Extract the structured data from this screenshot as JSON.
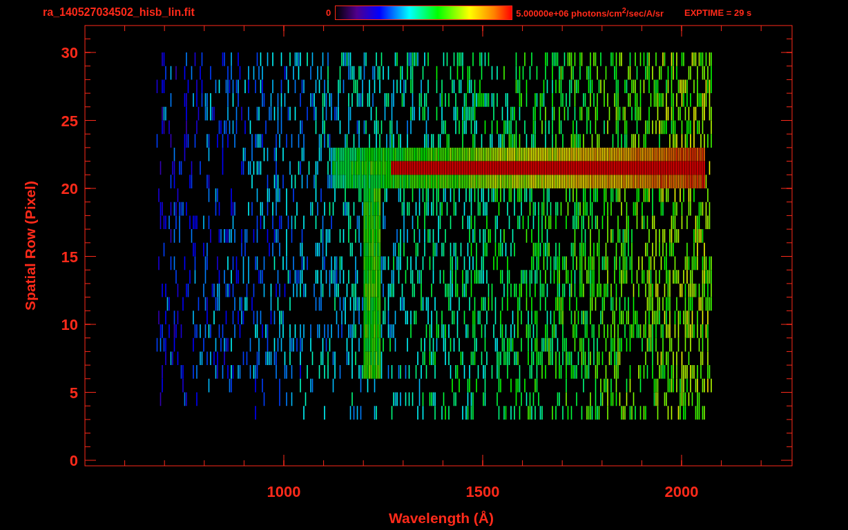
{
  "header": {
    "filename": "ra_140527034502_hisb_lin.fit",
    "colorbar": {
      "min_label": "0",
      "max_label": "5.00000e+06 photons/cm$^{2}$/sec/A/sr"
    },
    "exposure": "EXPTIME = 29 s"
  },
  "plot": {
    "xlabel": "Wavelength (Å)",
    "ylabel": "Spatial Row (Pixel)",
    "xticks": [
      "1000",
      "1500",
      "2000"
    ],
    "yticks": [
      "30",
      "25",
      "20",
      "15",
      "10",
      "5",
      "0"
    ]
  }
}
